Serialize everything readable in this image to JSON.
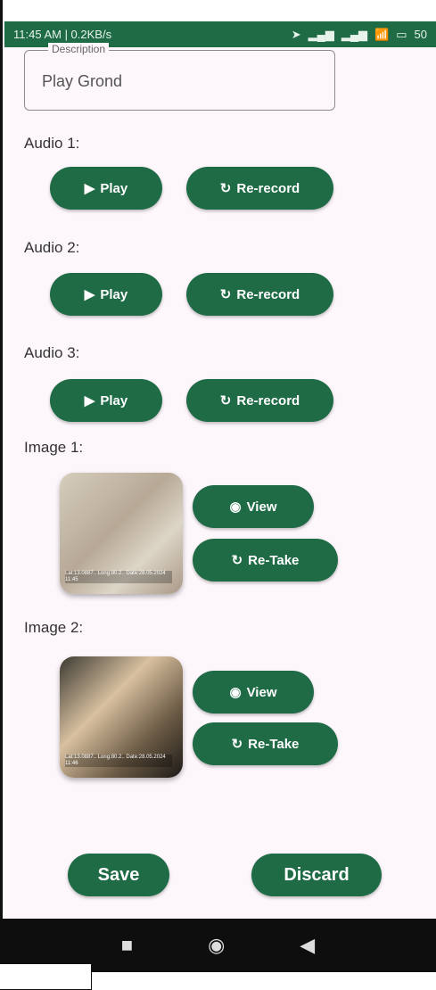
{
  "status": {
    "time_speed": "11:45 AM | 0.2KB/s",
    "battery": "50"
  },
  "description": {
    "label": "Description",
    "value": "Play Grond"
  },
  "audio": [
    {
      "label": "Audio 1:",
      "play": "Play",
      "rerecord": "Re-record"
    },
    {
      "label": "Audio 2:",
      "play": "Play",
      "rerecord": "Re-record"
    },
    {
      "label": "Audio 3:",
      "play": "Play",
      "rerecord": "Re-record"
    }
  ],
  "images": [
    {
      "label": "Image 1:",
      "view": "View",
      "retake": "Re-Take",
      "thumb_text": "Lat:13.0887..\nLong:80.2..\nDate:28.05.2024 11:45"
    },
    {
      "label": "Image 2:",
      "view": "View",
      "retake": "Re-Take",
      "thumb_text": "Lat:13.0887..\nLong:80.2..\nDate:28.05.2024 11:46"
    }
  ],
  "actions": {
    "save": "Save",
    "discard": "Discard"
  },
  "icons": {
    "play": "play-icon",
    "rerecord": "refresh-icon",
    "view": "eye-icon",
    "retake": "refresh-icon",
    "nav_square": "stop-icon",
    "nav_home": "home-icon",
    "nav_back": "back-icon"
  },
  "colors": {
    "accent": "#1f6b46",
    "surface": "#fdf7fc"
  }
}
